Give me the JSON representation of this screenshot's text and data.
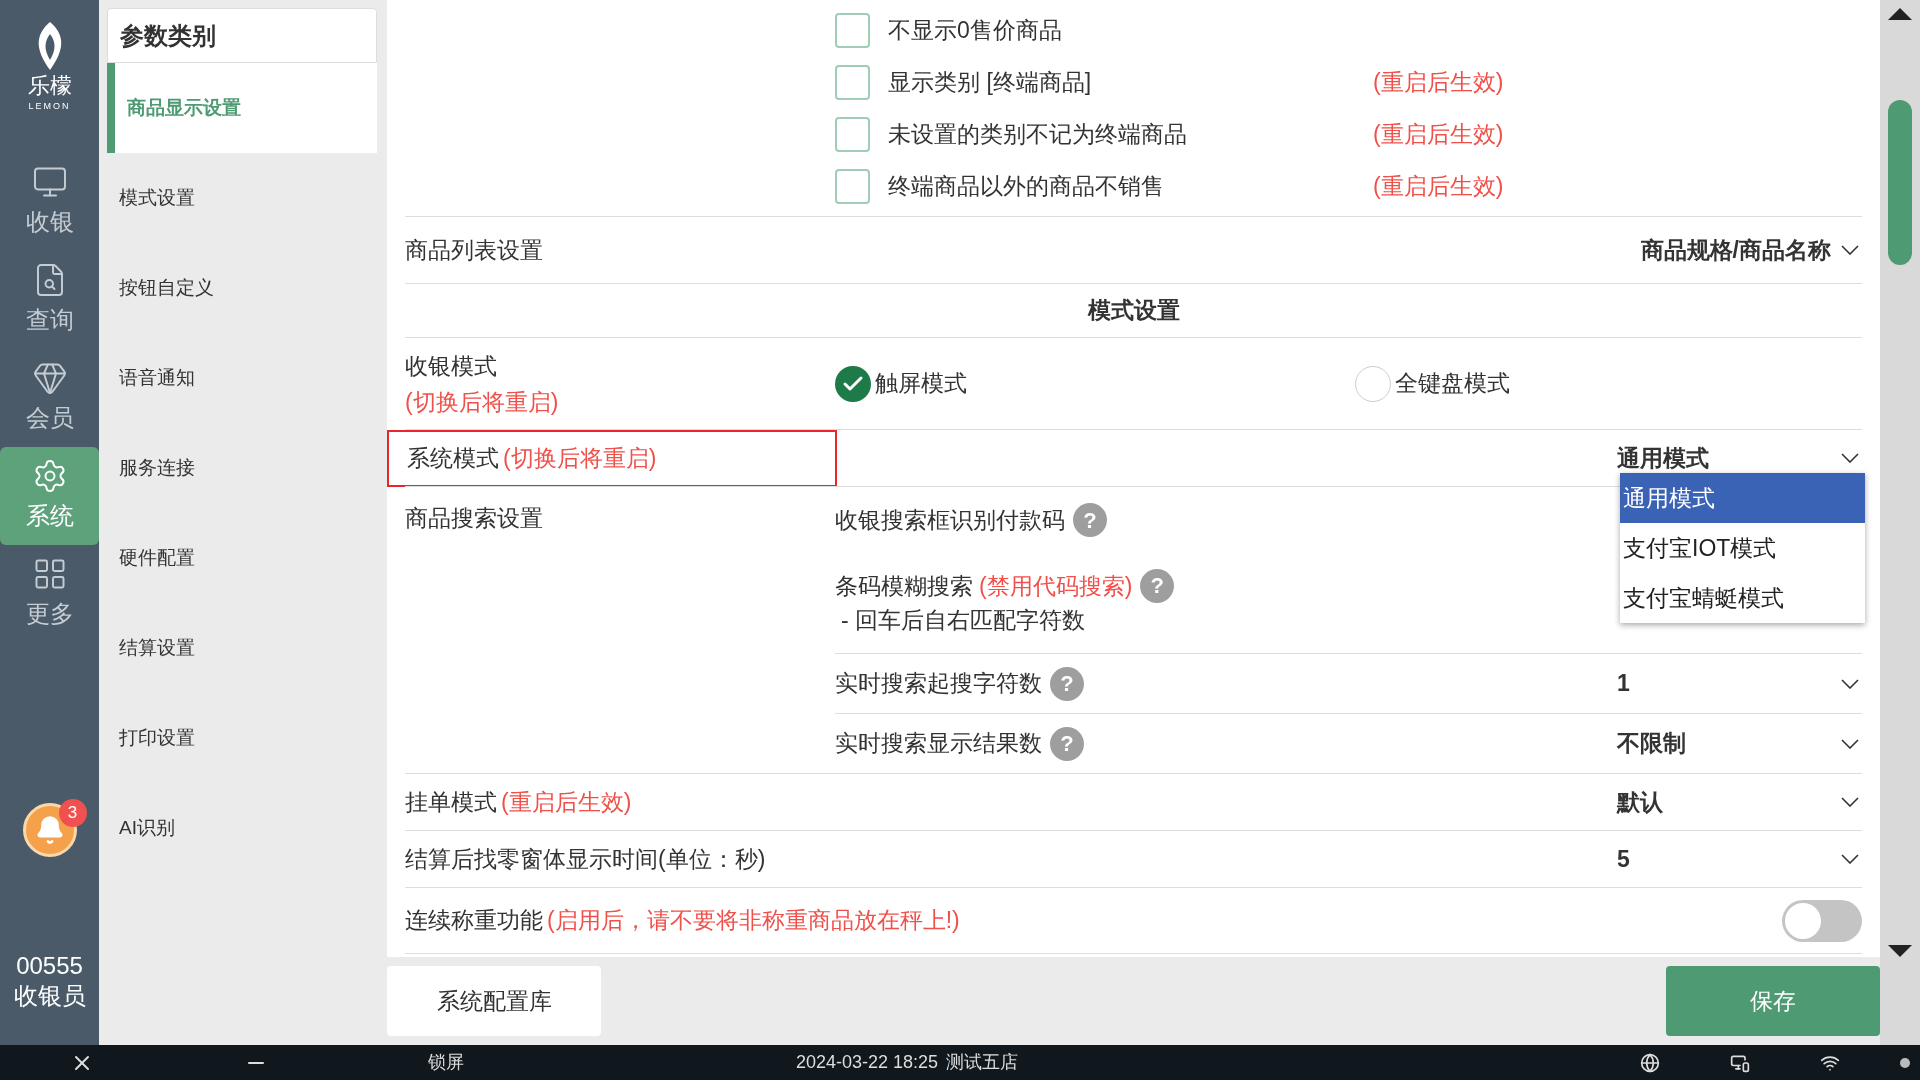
{
  "nav": {
    "logo_text": "乐檬",
    "logo_sub": "LEMON",
    "items": [
      {
        "label": "收银",
        "kind": "cashier",
        "selected": false
      },
      {
        "label": "查询",
        "kind": "query",
        "selected": false
      },
      {
        "label": "会员",
        "kind": "member",
        "selected": false
      },
      {
        "label": "系统",
        "kind": "settings",
        "selected": true
      },
      {
        "label": "更多",
        "kind": "more",
        "selected": false
      }
    ],
    "notification_count": "3",
    "user_code": "00555",
    "user_role": "收银员"
  },
  "categories": {
    "title": "参数类别",
    "items": [
      {
        "label": "商品显示设置",
        "selected": true
      },
      {
        "label": "模式设置",
        "selected": false
      },
      {
        "label": "按钮自定义",
        "selected": false
      },
      {
        "label": "语音通知",
        "selected": false
      },
      {
        "label": "服务连接",
        "selected": false
      },
      {
        "label": "硬件配置",
        "selected": false
      },
      {
        "label": "结算设置",
        "selected": false
      },
      {
        "label": "打印设置",
        "selected": false
      },
      {
        "label": "AI识别",
        "selected": false
      }
    ]
  },
  "checkbox_rows": [
    {
      "label": "不显示0售价商品",
      "checked": false
    },
    {
      "label": "显示类别 [终端商品]",
      "note": "(重启后生效)",
      "checked": false
    },
    {
      "label": "未设置的类别不记为终端商品",
      "note": "(重启后生效)",
      "checked": false
    },
    {
      "label": "终端商品以外的商品不销售",
      "note": "(重启后生效)",
      "checked": false
    }
  ],
  "list_setting": {
    "label": "商品列表设置",
    "value": "商品规格/商品名称"
  },
  "section_title": "模式设置",
  "cashier_mode": {
    "label": "收银模式",
    "note": "(切换后将重启)",
    "options": [
      {
        "label": "触屏模式",
        "selected": true
      },
      {
        "label": "全键盘模式",
        "selected": false
      }
    ]
  },
  "system_mode": {
    "label": "系统模式",
    "note": "(切换后将重启)",
    "highlighted": true,
    "value": "通用模式",
    "dropdown_open": true,
    "options": [
      {
        "label": "通用模式",
        "selected": true
      },
      {
        "label": "支付宝IOT模式",
        "selected": false
      },
      {
        "label": "支付宝蜻蜓模式",
        "selected": false
      }
    ]
  },
  "search_settings": {
    "label": "商品搜索设置",
    "items": [
      {
        "label": "收银搜索框识别付款码",
        "help": "?"
      },
      {
        "label": "条码模糊搜索",
        "note": "(禁用代码搜索)",
        "help": "?",
        "sub_label": "- 回车后自右匹配字符数"
      },
      {
        "label": "实时搜索起搜字符数",
        "help": "?",
        "value": "1"
      },
      {
        "label": "实时搜索显示结果数",
        "help": "?",
        "value": "不限制"
      }
    ]
  },
  "rows": [
    {
      "kind": "select",
      "label": "挂单模式",
      "note": "(重启后生效)",
      "value": "默认"
    },
    {
      "kind": "select",
      "label": "结算后找零窗体显示时间(单位：秒)",
      "value": "5"
    },
    {
      "kind": "toggle",
      "label": "连续称重功能",
      "note": "(启用后，请不要将非称重商品放在秤上!)",
      "on": false
    }
  ],
  "footer": {
    "config_button": "系统配置库",
    "save_button": "保存"
  },
  "status_bar": {
    "lock": "锁屏",
    "datetime": "2024-03-22 18:25",
    "store": "测试五店"
  }
}
